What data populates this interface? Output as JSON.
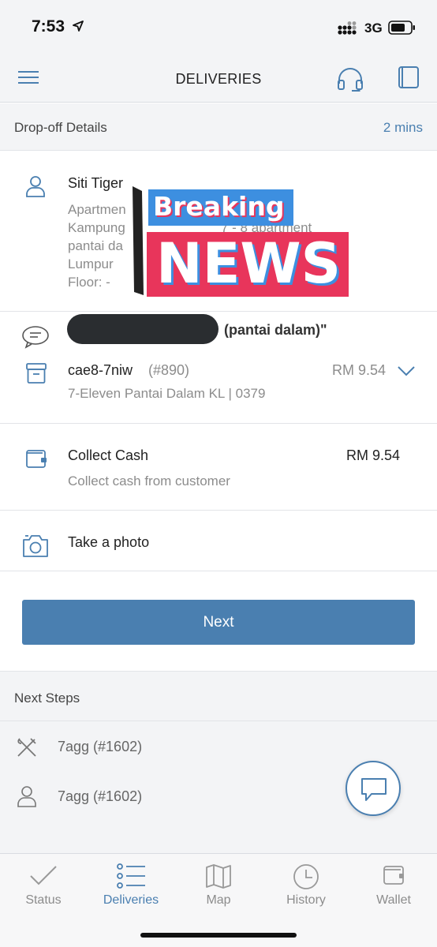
{
  "status_bar": {
    "time": "7:53",
    "network": "3G"
  },
  "header": {
    "title": "DELIVERIES"
  },
  "dropoff": {
    "section_title": "Drop-off Details",
    "eta": "2 mins",
    "customer_name": "Siti Tiger",
    "address_lines": [
      "Apartmen",
      "Kampung",
      "pantai da",
      "Lumpur",
      "Floor: -"
    ],
    "address_trailing": "7 - 8 apartment",
    "note": "(pantai dalam)\"",
    "order_id": "cae8-7niw",
    "order_number": "(#890)",
    "order_total": "RM 9.54",
    "store": "7-Eleven Pantai Dalam KL | 0379",
    "cash_title": "Collect Cash",
    "cash_amount": "RM 9.54",
    "cash_sub": "Collect cash from customer",
    "photo_label": "Take a photo",
    "next_label": "Next"
  },
  "overlay": {
    "line1": "Breaking",
    "line2": "NEWS"
  },
  "next_steps": {
    "section_title": "Next Steps",
    "items": [
      {
        "label": "7agg (#1602)",
        "icon": "fork-knife-icon"
      },
      {
        "label": "7agg (#1602)",
        "icon": "person-icon"
      }
    ]
  },
  "tabs": [
    {
      "label": "Status",
      "icon": "check-icon",
      "active": false
    },
    {
      "label": "Deliveries",
      "icon": "list-icon",
      "active": true
    },
    {
      "label": "Map",
      "icon": "map-icon",
      "active": false
    },
    {
      "label": "History",
      "icon": "clock-icon",
      "active": false
    },
    {
      "label": "Wallet",
      "icon": "wallet-icon",
      "active": false
    }
  ],
  "colors": {
    "accent": "#4a7fb0",
    "overlay_red": "#e8355b",
    "overlay_blue": "#3d8fe0"
  }
}
